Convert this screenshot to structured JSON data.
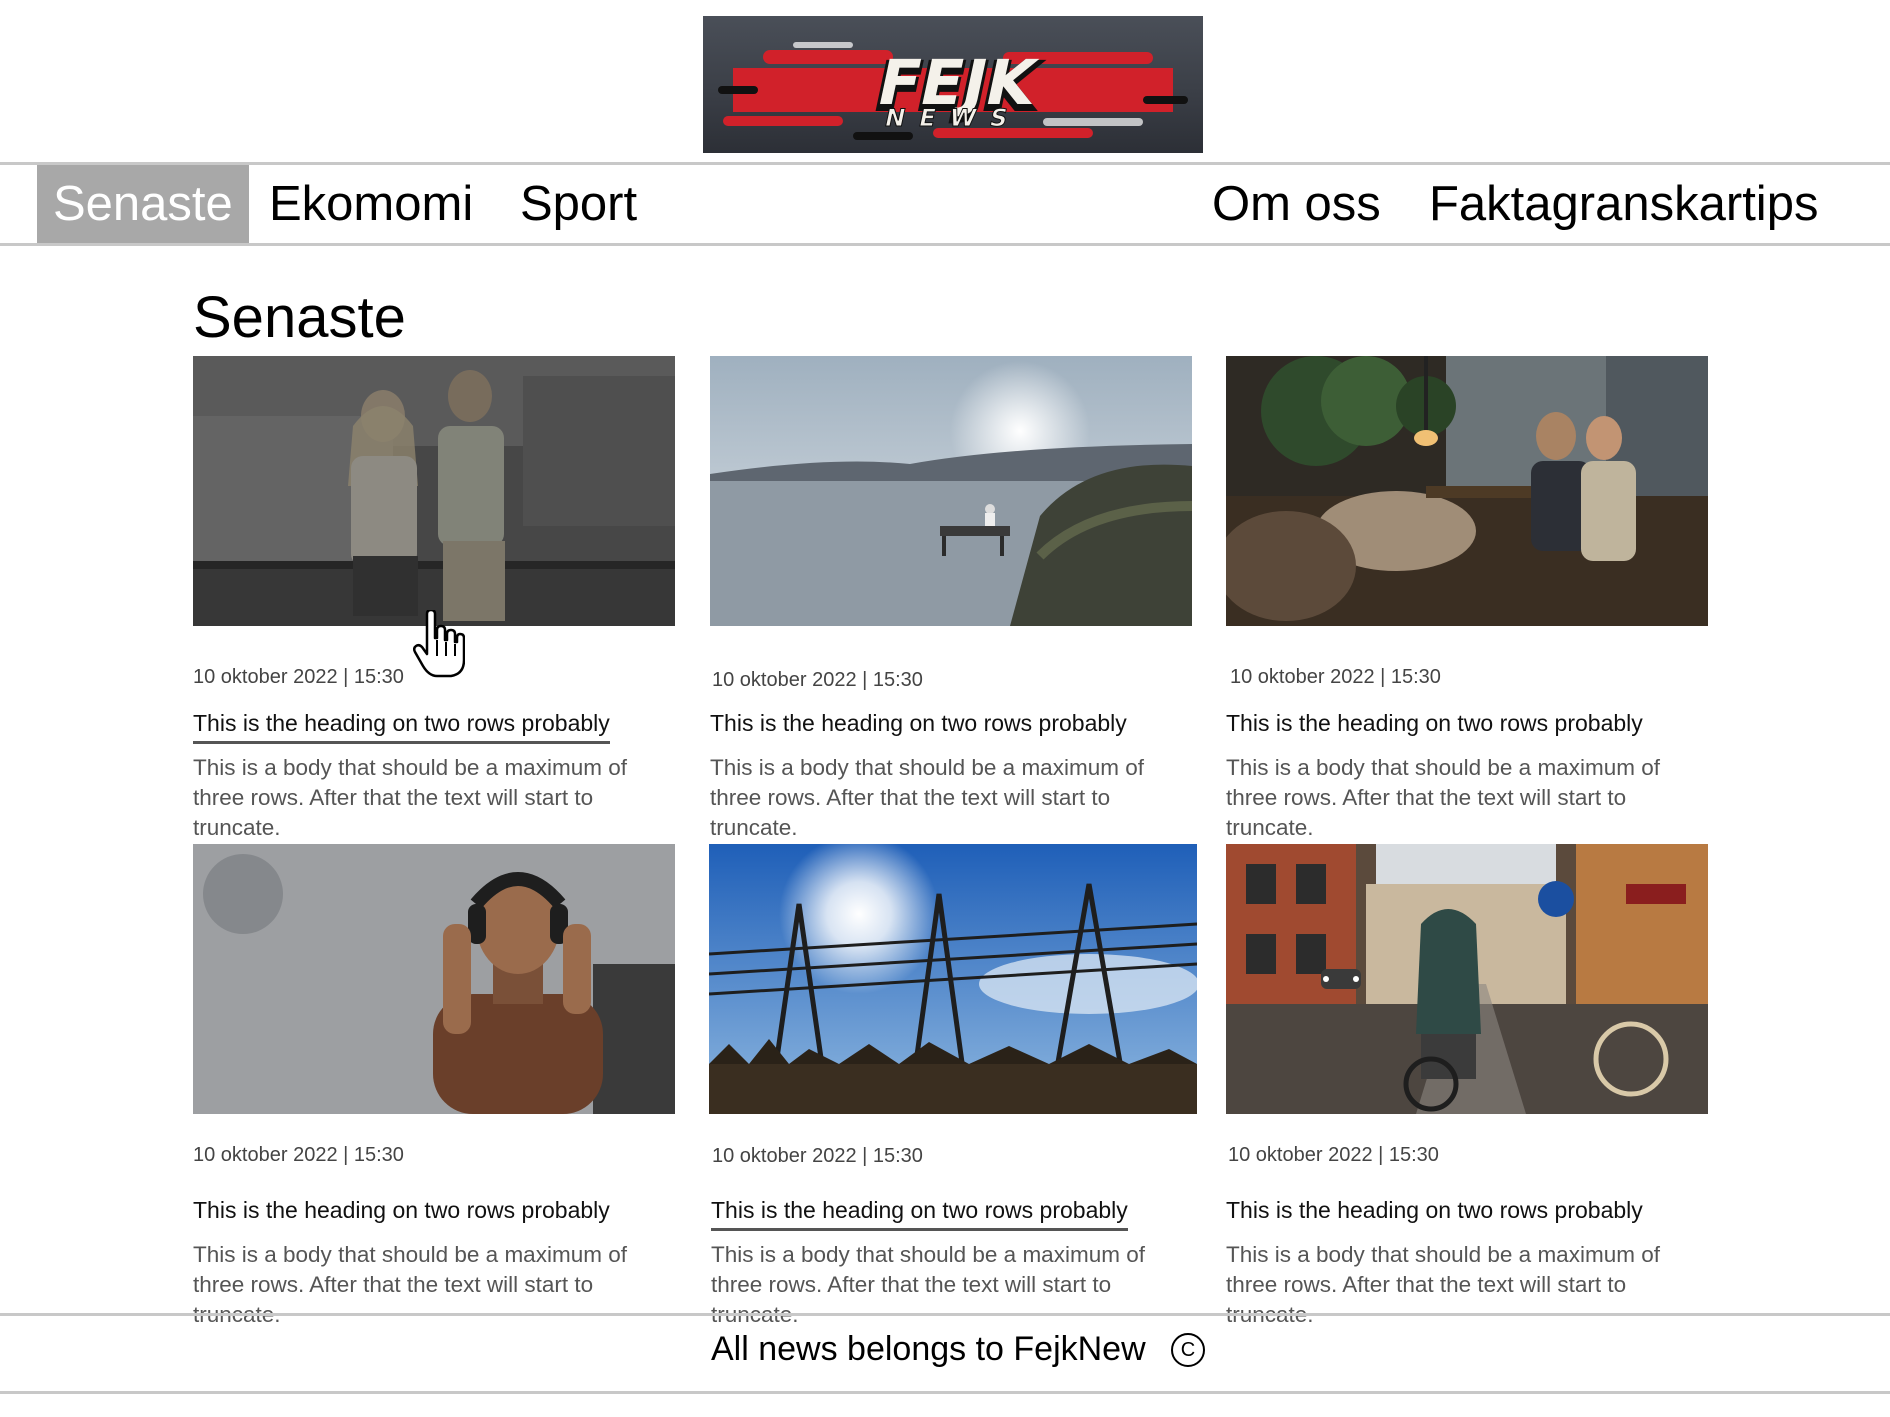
{
  "logo": {
    "title": "FEJK",
    "subtitle": "NEWS"
  },
  "nav": {
    "left": [
      {
        "label": "Senaste",
        "active": true
      },
      {
        "label": "Ekomomi",
        "active": false
      },
      {
        "label": "Sport",
        "active": false
      }
    ],
    "right": [
      {
        "label": "Om oss"
      },
      {
        "label": "Faktagranskartips"
      }
    ]
  },
  "section_title": "Senaste",
  "articles": [
    {
      "image": "people-office-photo",
      "date": "10 oktober 2022 | 15:30",
      "heading": "This is the heading on two rows probably",
      "body": "This is a body that should be a maximum of three rows. After that the text will start to truncate."
    },
    {
      "image": "lake-dock-photo",
      "date": "10 oktober 2022 | 15:30",
      "heading": "This is the heading on two rows probably",
      "body": "This is a body that should be a maximum of three rows. After that the text will start to truncate."
    },
    {
      "image": "cafe-interior-photo",
      "date": "10 oktober 2022 | 15:30",
      "heading": "This is the heading on two rows probably",
      "body": "This is a body that should be a maximum of three rows. After that the text will start to truncate."
    },
    {
      "image": "man-headphones-photo",
      "date": "10 oktober 2022 | 15:30",
      "heading": "This is the heading on two rows probably",
      "body": "This is a body that should be a maximum of three rows. After that the text will start to truncate."
    },
    {
      "image": "power-lines-photo",
      "date": "10 oktober 2022 | 15:30",
      "heading": "This is the heading on two rows probably",
      "body": "This is a body that should be a maximum of three rows. After that the text will start to truncate."
    },
    {
      "image": "rainy-street-cyclist-photo",
      "date": "10 oktober 2022 | 15:30",
      "heading": "This is the heading on two rows probably",
      "body": "This is a body that should be a maximum of three rows. After that the text will start to truncate."
    }
  ],
  "footer": {
    "text": "All news belongs to FejkNew",
    "copyright_symbol": "C"
  }
}
